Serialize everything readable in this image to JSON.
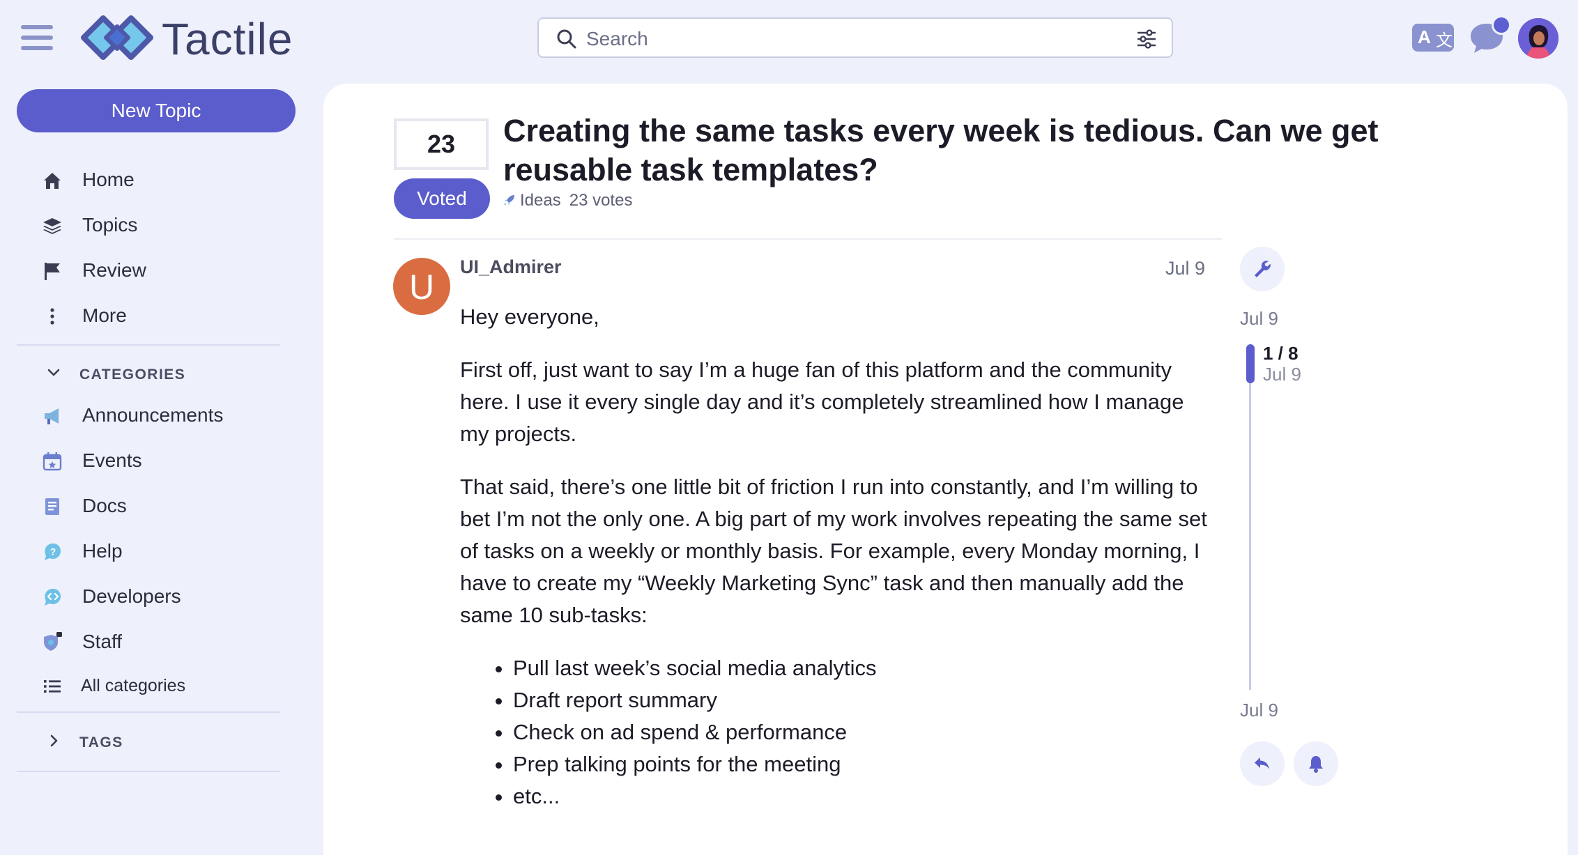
{
  "header": {
    "brand": "Tactile",
    "search": {
      "placeholder": "Search",
      "value": ""
    },
    "translate_icon": {
      "left": "A",
      "right": "文"
    }
  },
  "sidebar": {
    "new_topic_label": "New Topic",
    "nav": [
      {
        "label": "Home",
        "icon": "home-icon"
      },
      {
        "label": "Topics",
        "icon": "layers-icon"
      },
      {
        "label": "Review",
        "icon": "flag-icon"
      },
      {
        "label": "More",
        "icon": "more-vertical-icon"
      }
    ],
    "categories_heading": "CATEGORIES",
    "categories": [
      {
        "label": "Announcements",
        "icon": "megaphone-icon"
      },
      {
        "label": "Events",
        "icon": "calendar-icon"
      },
      {
        "label": "Docs",
        "icon": "book-icon"
      },
      {
        "label": "Help",
        "icon": "help-bubble-icon"
      },
      {
        "label": "Developers",
        "icon": "code-bubble-icon"
      },
      {
        "label": "Staff",
        "icon": "shield-lock-icon"
      },
      {
        "label": "All categories",
        "icon": "list-icon"
      }
    ],
    "tags_heading": "TAGS"
  },
  "topic": {
    "vote_count": "23",
    "voted_label": "Voted",
    "title": "Creating the same tasks every week is tedious. Can we get reusable task templates?",
    "category": "Ideas",
    "votes_text": "23 votes"
  },
  "post": {
    "avatar_letter": "U",
    "username": "UI_Admirer",
    "date": "Jul 9",
    "paragraphs": [
      "Hey everyone,",
      "First off, just want to say I’m a huge fan of this platform and the community here. I use it every single day and it’s completely streamlined how I manage my projects.",
      "That said, there’s one little bit of friction I run into constantly, and I’m willing to bet I’m not the only one. A big part of my work involves repeating the same set of tasks on a weekly or monthly basis. For example, every Monday morning, I have to create my “Weekly Marketing Sync” task and then manually add the same 10 sub-tasks:"
    ],
    "bullets": [
      "Pull last week’s social media analytics",
      "Draft report summary",
      "Check on ad spend & performance",
      "Prep talking points for the meeting",
      "etc..."
    ]
  },
  "timeline": {
    "start_date": "Jul 9",
    "position": "1 / 8",
    "position_date": "Jul 9",
    "end_date": "Jul 9"
  },
  "colors": {
    "accent": "#5b5dcc",
    "background": "#eef0fb",
    "avatar": "#d96d41"
  }
}
